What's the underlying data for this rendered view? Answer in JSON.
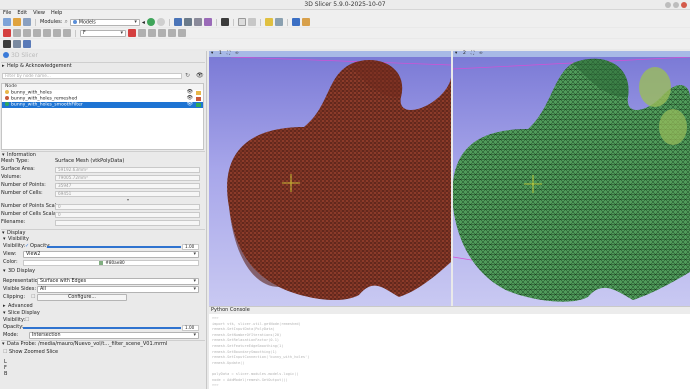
{
  "window": {
    "title": "3D Slicer 5.9.0-2025-10-07"
  },
  "menu": [
    "File",
    "Edit",
    "View",
    "Help"
  ],
  "toolbar": {
    "modules_label": "Modules:",
    "module_selected": "Models",
    "markup_selected": "F"
  },
  "logo_text": "3D Slicer",
  "sections": {
    "help": "Help & Acknowledgement",
    "information": "Information",
    "display": "Display",
    "visibility": "Visibility",
    "display3d": "3D Display",
    "advanced": "Advanced",
    "slice_display": "Slice Display",
    "data_probe": "Data Probe: /media/mauro/Nuevo_vol/t..._filter_scene_V01.mrml"
  },
  "filter": {
    "placeholder": "Filter by node name..."
  },
  "scene": {
    "header": "Node",
    "nodes": [
      {
        "name": "bunny_with_holes",
        "color": "#e8b84a",
        "selected": false
      },
      {
        "name": "bunny_with_holes_remeshed",
        "color": "#c85a3a",
        "selected": false
      },
      {
        "name": "bunny_with_holes_smoothFilter",
        "color": "#2ea85a",
        "selected": true
      }
    ]
  },
  "information": {
    "mesh_type_label": "Mesh Type:",
    "mesh_type_value": "Surface Mesh (vtkPolyData)",
    "surface_area_label": "Surface Area:",
    "surface_area_value": "59192.63mm²",
    "volume_label": "Volume:",
    "volume_value": "79005.72mm³",
    "points_label": "Number of Points:",
    "points_value": "35947",
    "cells_label": "Number of Cells:",
    "cells_value": "69451",
    "points_scalars_label": "Number of Points Scalars:",
    "points_scalars_value": "0",
    "cells_scalars_label": "Number of Cells Scalars:",
    "cells_scalars_value": "0",
    "filename_label": "Filename:"
  },
  "visibility_panel": {
    "visibility_label": "Visibility:",
    "opacity_label": "Opacity:",
    "opacity_value": "1.00",
    "opacity_fraction": 1.0,
    "view_label": "View:",
    "view_value": "View2",
    "color_label": "Color:",
    "color_value": "#80ae80"
  },
  "display3d_panel": {
    "representation_label": "Representation:",
    "representation_value": "Surface with Edges",
    "visible_sides_label": "Visible Sides:",
    "visible_sides_value": "All",
    "clipping_label": "Clipping:",
    "configure_label": "Configure..."
  },
  "slice_panel": {
    "visibility_label": "Visibility:",
    "opacity_label": "Opacity:",
    "opacity_value": "1.00",
    "mode_label": "Mode:",
    "mode_value": "Intersection"
  },
  "probe": {
    "show_zoomed": "Show Zoomed Slice",
    "lines": [
      "L",
      "F",
      "B"
    ]
  },
  "views": {
    "view1_label": "1",
    "view2_label": "2",
    "view1_color": "#8c3b2a",
    "view2_color": "#3f8a4a"
  },
  "console": {
    "title": "Python Console",
    "lines": [
      ">>>",
      "import vtk, slicer.util.getNode(remeshed)",
      "remesh.SetInputData(PolyData)",
      "remesh.SetNumberOfIterations(20)",
      "remesh.SetRelaxationFactor(0.1)",
      "remesh.SetFeatureEdgeSmoothing(1)",
      "remesh.SetBoundarySmoothing(1)",
      "remesh.SetInputConnection('bunny_with_holes')",
      "remesh.Update()",
      "",
      "polyData = slicer.modules.models.logic()",
      "node = AddModel(remesh.GetOutput())",
      ">>>"
    ]
  }
}
